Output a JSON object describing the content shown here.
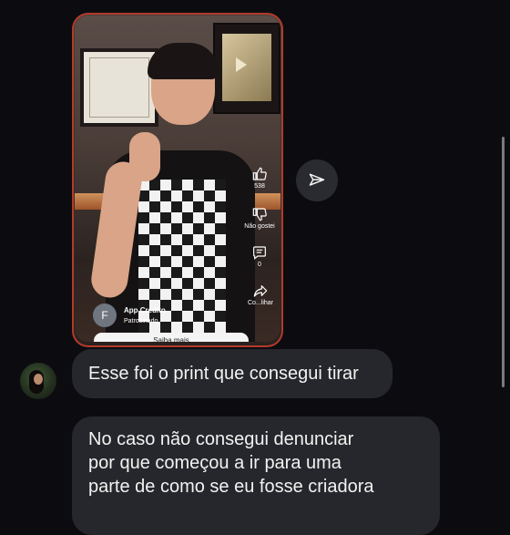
{
  "shared_reel": {
    "likes_count": "538",
    "dislike_label": "Não gostei",
    "comments_count": "0",
    "share_label": "Co...lihar",
    "sponsor_initial": "F",
    "sponsor_name": "App Credito",
    "sponsor_tag": "Patrocinado",
    "cta_label": "Saiba mais"
  },
  "messages": [
    {
      "text": "Esse foi o print que consegui tirar"
    },
    {
      "lines": [
        "No caso não consegui denunciar",
        "por que começou a ir para uma",
        "parte de como se eu fosse criadora"
      ]
    }
  ],
  "colors": {
    "background": "#0c0c10",
    "bubble": "#26272c",
    "card_border": "#b33a2a"
  },
  "icons": [
    "like-icon",
    "dislike-icon",
    "comment-icon",
    "share-icon",
    "send-icon"
  ]
}
